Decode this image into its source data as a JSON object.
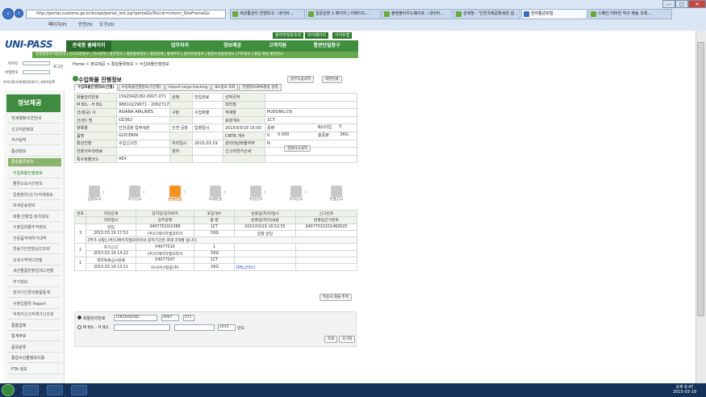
{
  "browser": {
    "address": "http://portal.customs.go.kr/kcsipt/portal_link.jsp?portalGoToLink=inform_SiteFrameGo",
    "tabs": [
      "세관통관이 진행되고 : 네이버...",
      "일문답변 1 페이지 | 이베이드...",
      "블랜블라우드웨이프 : 네이버...",
      "관세청 - '인천국제공항세관 설...",
      "전자통관포털",
      "스페인 어떠한 작구 배송 조회..."
    ],
    "menu": [
      "페이지(P)",
      "안전(S)",
      "도구(O)"
    ],
    "win": {
      "min": "—",
      "max": "□",
      "close": "✕"
    }
  },
  "site": {
    "logo": "UNI-PASS",
    "toplinks": [
      "참여자정보조회",
      "마이페이지",
      "사이트맵"
    ],
    "nav": [
      "관세청 홈페이지",
      "업무처리",
      "정보제공",
      "고객지원",
      "통관단일창구"
    ],
    "subnav": "관세청정보이용안내 | 신고지원정보 | 자사실적 | 통관정보 | 통합물류정보 | 통합업체 | 통계부호 | 품목분류정보 | 통합수입물류정보 | FTA정보 | 통합 화물 통관정보"
  },
  "login": {
    "id_label": "아이디",
    "pw_label": "비밀번호",
    "login_btn": "로그인",
    "join_links": "아이디찾기/비밀번호찾기 | 사용자등록"
  },
  "side": {
    "title": "정보제공",
    "items": [
      {
        "label": "전세행정사건안내",
        "kind": "item"
      },
      {
        "label": "신고지원정보",
        "kind": "item"
      },
      {
        "label": "자사실적",
        "kind": "item"
      },
      {
        "label": "통관정보",
        "kind": "item"
      },
      {
        "label": "통합물류정보",
        "kind": "sel"
      },
      {
        "label": "수입화물진행정보",
        "kind": "subsel"
      },
      {
        "label": "물류소요시간정보",
        "kind": "sub"
      },
      {
        "label": "입출항위선(기)적재정보",
        "kind": "sub"
      },
      {
        "label": "보세운송정보",
        "kind": "sub"
      },
      {
        "label": "화물 반출입·장치정보",
        "kind": "sub"
      },
      {
        "label": "수출입화물추적정보",
        "kind": "sub"
      },
      {
        "label": "선용품적재허가내역",
        "kind": "sub"
      },
      {
        "label": "반송기간연장승인조회",
        "kind": "sub"
      },
      {
        "label": "보세구역재고현황",
        "kind": "sub"
      },
      {
        "label": "세관물품반출입재고현황",
        "kind": "sub"
      },
      {
        "label": "부가정보",
        "kind": "sub"
      },
      {
        "label": "장치기간경과물품통계",
        "kind": "sub"
      },
      {
        "label": "수출입물류 Report",
        "kind": "sub"
      },
      {
        "label": "적재지신고적재가신조회",
        "kind": "sub"
      },
      {
        "label": "통통업체",
        "kind": "item"
      },
      {
        "label": "통계부호",
        "kind": "item"
      },
      {
        "label": "품목분류",
        "kind": "item"
      },
      {
        "label": "통합수산물정보이용",
        "kind": "item"
      },
      {
        "label": "FTA 정보",
        "kind": "item"
      }
    ]
  },
  "breadcrumb": "Home > 정보제공 > 통합물류정보 > 수입화물진행정보",
  "page": {
    "title": "수입화물 진행정보",
    "btn_help": "업무도움내역",
    "btn_print": "화면인쇄"
  },
  "tabs": [
    "수입화물진행정보(건별)",
    "수입화물진행정보(기간별)",
    "import cargo tracking",
    "B/L정보 조회",
    "진행정보SMS발송 설정"
  ],
  "info": {
    "rows": [
      [
        "화물관리번호",
        "15KZ0AZU82-0007-071",
        "상태",
        "반입완료",
        "선박국적",
        ""
      ],
      [
        "M B/L - H B/L",
        "98810229671 - 2062717581",
        "",
        "",
        "대리점",
        ""
      ],
      [
        "선(항공) 사",
        "ASIANA AIRLINES",
        "구분",
        "수입화물",
        "적재항",
        "PUDONG,CN"
      ],
      [
        "선(편) 명",
        "OZ362",
        "",
        "",
        "포장개수",
        "1CT"
      ],
      [
        "양륙항",
        "인천공항 업무세관",
        "인천 공항",
        "입항일시",
        "2015/03/19 15:00",
        "중량"
      ],
      [
        "품명",
        "GLYCERIN",
        "",
        "",
        "CNTR 개수",
        "0"
      ],
      [
        "통관진행",
        "수입신고전",
        "처리일시",
        "2015.03.19",
        "관리대상화물여부",
        "N"
      ],
      [
        "반출의무과태료",
        "",
        "양차",
        "",
        "신고지연가산세",
        ""
      ],
      [
        "특수화물코드",
        "AEX",
        "",
        "",
        "",
        ""
      ]
    ],
    "bl_type_label": "B/L타입",
    "bl_type": "X",
    "volume": "0.000",
    "total_weight_label": "총중량",
    "total_weight": ".5KG",
    "container_btn": "컨테이너내역",
    "weight_value": "",
    "spec_label": "면적"
  },
  "process": {
    "steps": [
      "입항보고",
      "하기신고",
      "운송반입",
      "보세운송",
      "수입신고",
      "수리신고",
      "반출신고"
    ],
    "current": 2
  },
  "history": {
    "headers1": [
      "번호",
      "처리단계",
      "장치장/장치위치",
      "포장개수",
      "반출입(처리)일시",
      "신고번호"
    ],
    "headers2": [
      "",
      "처리일시",
      "장치장명",
      "중 량",
      "반출입(처리)내용",
      "반출입근거번호"
    ],
    "rows": [
      {
        "no": "3",
        "step": "반입",
        "loc_code": "04077010/2388",
        "pkg": "1CT",
        "inout_date": "2015/03/19 16:52:55",
        "decl_no": "04077010151460025",
        "date": "2015.03.19 17:52",
        "loc_name": "(주)디에이치엘코리아",
        "weight": ".5KG",
        "content": "입항 반입",
        "ref": "",
        "note": "[부가 사항] (주)디에이치엘코리아의 장치기간은 최대 3개월 입니다."
      },
      {
        "no": "2",
        "step": "하기신고",
        "loc_code": "04077010",
        "pkg": "1",
        "inout_date": "",
        "decl_no": "",
        "date": "2015.03.19 14:22",
        "loc_name": "(주)디에이치엘코리아",
        "weight": ".5KG",
        "content": "",
        "ref": "",
        "note": ""
      },
      {
        "no": "1",
        "step": "적하목록심사완료",
        "loc_code": "04077007",
        "pkg": "1CT",
        "inout_date": "",
        "decl_no": "",
        "date": "2015.03.19 13:11",
        "loc_name": "아시아나항공(주)",
        "weight": ".5KG",
        "content": "DHL코리아",
        "ref": "",
        "note": ""
      }
    ],
    "more_btn": "특송사 화물 추적"
  },
  "search": {
    "opt1": "화물관리번호",
    "opt2": "M B/L - H B/L",
    "mrn": "15KZ0AZU82",
    "msn": "0007",
    "hsn": "071",
    "year": "2015",
    "year_unit": "년도",
    "query_btn": "조회",
    "reset_btn": "초기화"
  },
  "taskbar": {
    "time": "오후 6:47",
    "date": "2015-03-19"
  }
}
